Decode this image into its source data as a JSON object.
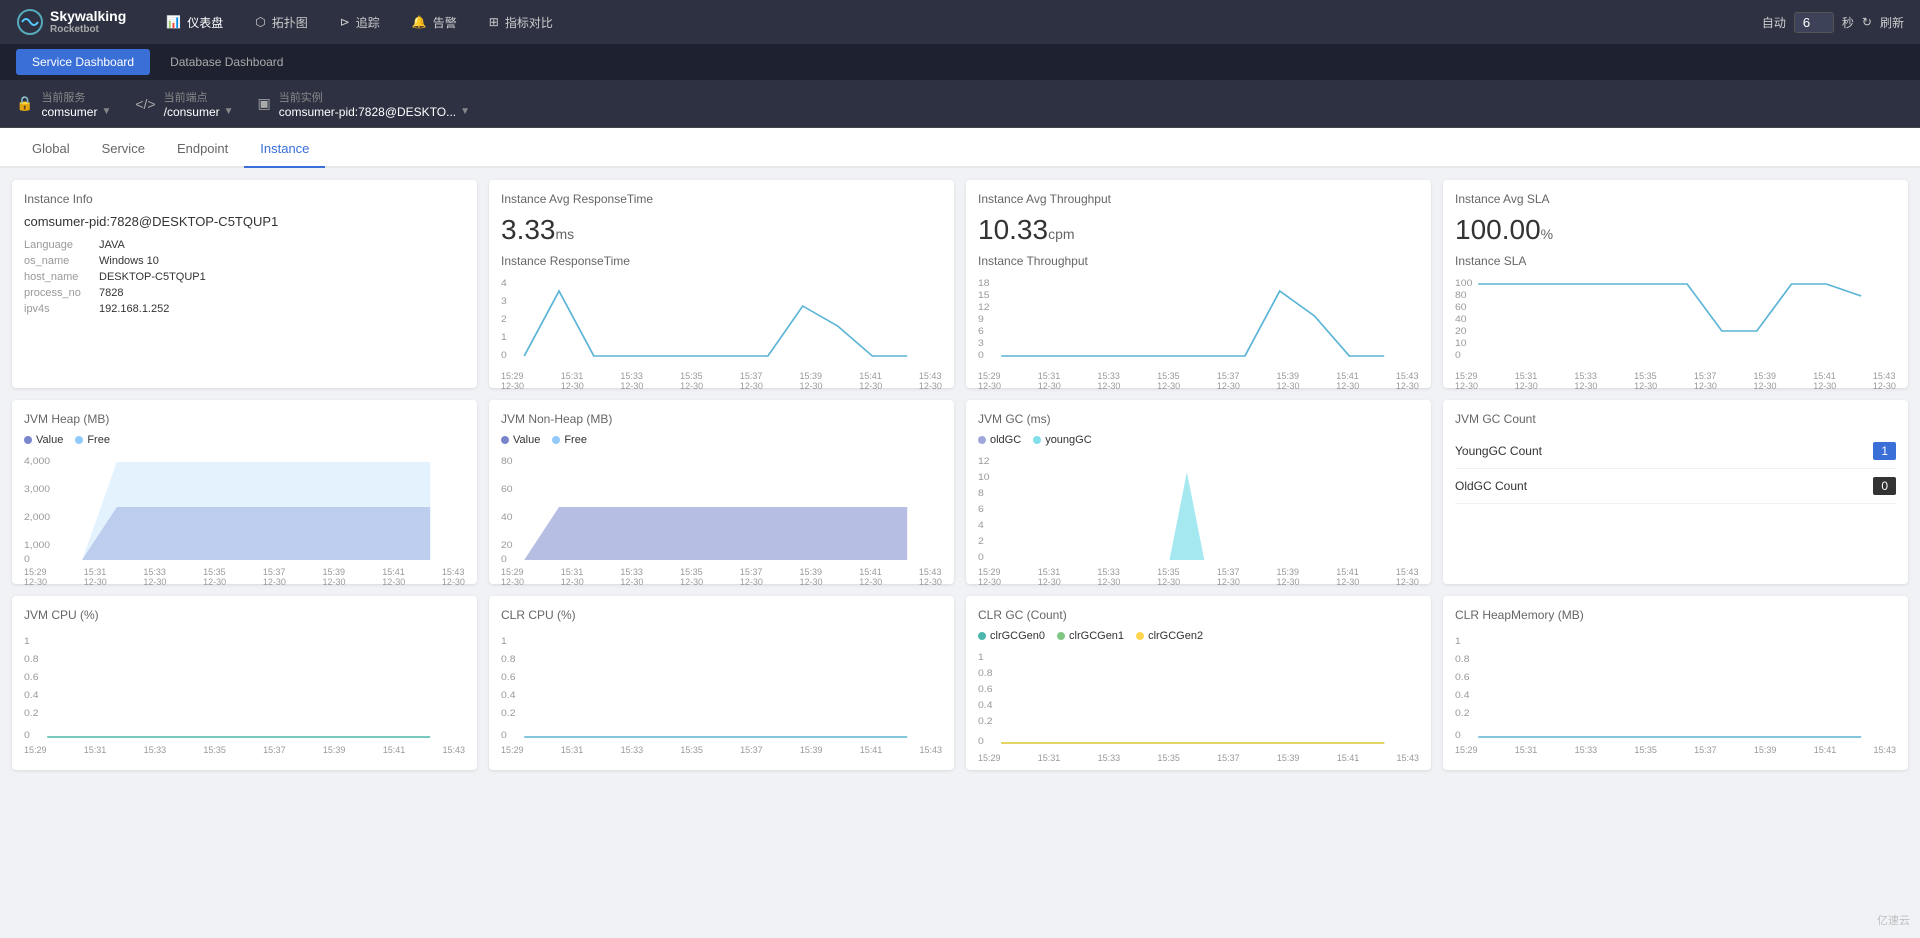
{
  "app": {
    "logo_text": "Skywalking",
    "sub_text": "Rocketbot"
  },
  "nav": {
    "items": [
      {
        "label": "仪表盘",
        "icon": "📊",
        "active": true
      },
      {
        "label": "拓扑图",
        "icon": "🔀",
        "active": false
      },
      {
        "label": "追踪",
        "icon": "📍",
        "active": false
      },
      {
        "label": "告警",
        "icon": "🔔",
        "active": false
      },
      {
        "label": "指标对比",
        "icon": "📈",
        "active": false
      }
    ],
    "auto_label": "自动",
    "refresh_value": "6",
    "second_label": "秒",
    "refresh_label": "刷新"
  },
  "dashboard_tabs": [
    {
      "label": "Service Dashboard",
      "active": true
    },
    {
      "label": "Database Dashboard",
      "active": false
    }
  ],
  "selectors": {
    "service_label": "当前服务",
    "service_value": "comsumer",
    "endpoint_label": "当前端点",
    "endpoint_value": "/consumer",
    "instance_label": "当前实例",
    "instance_value": "comsumer-pid:7828@DESKTO..."
  },
  "tabs": [
    {
      "label": "Global",
      "active": false
    },
    {
      "label": "Service",
      "active": false
    },
    {
      "label": "Endpoint",
      "active": false
    },
    {
      "label": "Instance",
      "active": true
    }
  ],
  "instance_info": {
    "title": "Instance Info",
    "name": "comsumer-pid:7828@DESKTOP-C5TQUP1",
    "language_label": "Language",
    "language_value": "JAVA",
    "os_label": "os_name",
    "os_value": "Windows 10",
    "host_label": "host_name",
    "host_value": "DESKTOP-C5TQUP1",
    "process_label": "process_no",
    "process_value": "7828",
    "ip_label": "ipv4s",
    "ip_value": "192.168.1.252"
  },
  "avg_response": {
    "title": "Instance Avg ResponseTime",
    "value": "3.33",
    "unit": "ms",
    "chart_title": "Instance ResponseTime"
  },
  "avg_throughput": {
    "title": "Instance Avg Throughput",
    "value": "10.33",
    "unit": "cpm",
    "chart_title": "Instance Throughput"
  },
  "avg_sla": {
    "title": "Instance Avg SLA",
    "value": "100.00",
    "unit": "%",
    "chart_title": "Instance SLA"
  },
  "jvm_heap": {
    "title": "JVM Heap (MB)",
    "legend": [
      {
        "label": "Value",
        "color": "#7986cb"
      },
      {
        "label": "Free",
        "color": "#90caf9"
      }
    ]
  },
  "jvm_nonheap": {
    "title": "JVM Non-Heap (MB)",
    "legend": [
      {
        "label": "Value",
        "color": "#7986cb"
      },
      {
        "label": "Free",
        "color": "#90caf9"
      }
    ]
  },
  "jvm_gc": {
    "title": "JVM GC (ms)",
    "legend": [
      {
        "label": "oldGC",
        "color": "#9fa8da"
      },
      {
        "label": "youngGC",
        "color": "#80deea"
      }
    ]
  },
  "jvm_gc_count": {
    "title": "JVM GC Count",
    "young_label": "YoungGC Count",
    "young_value": "1",
    "old_label": "OldGC Count",
    "old_value": "0"
  },
  "jvm_cpu": {
    "title": "JVM CPU (%)"
  },
  "clr_cpu": {
    "title": "CLR CPU (%)"
  },
  "clr_gc": {
    "title": "CLR GC (Count)",
    "legend": [
      {
        "label": "clrGCGen0",
        "color": "#4db6ac"
      },
      {
        "label": "clrGCGen1",
        "color": "#81c784"
      },
      {
        "label": "clrGCGen2",
        "color": "#ffd54f"
      }
    ]
  },
  "clr_heap": {
    "title": "CLR HeapMemory (MB)"
  },
  "time_labels": [
    "15:29\n12-30",
    "15:31\n12-30",
    "15:33\n12-30",
    "15:35\n12-30",
    "15:37\n12-30",
    "15:39\n12-30",
    "15:41\n12-30",
    "15:43\n12-30"
  ],
  "watermark": "亿速云"
}
